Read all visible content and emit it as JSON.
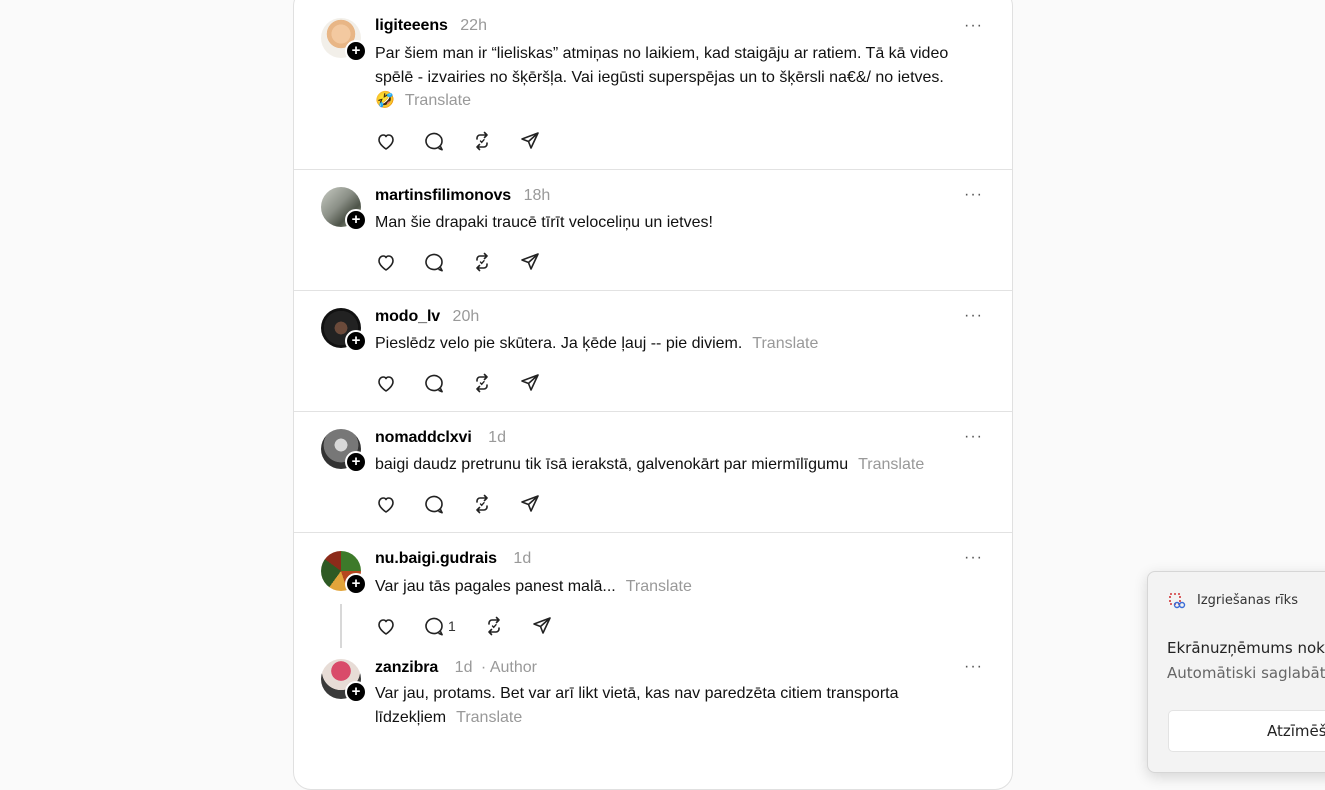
{
  "posts": [
    {
      "username": "ligiteeens",
      "time": "22h",
      "text_lines": [
        "Par šiem man ir “lieliskas” atmiņas no laikiem, kad staigāju ar ratiem. Tā kā video",
        "spēlē - izvairies no šķēršļa. Vai iegūsti superspējas un to šķērsli na€&/ no ietves."
      ],
      "emoji": "🤣",
      "translate": "Translate",
      "reply_count": ""
    },
    {
      "username": "martinsfilimonovs",
      "time": "18h",
      "text_lines": [
        "Man šie drapaki traucē tīrīt veloceliņu un ietves!"
      ],
      "translate": "",
      "reply_count": ""
    },
    {
      "username": "modo_lv",
      "time": "20h",
      "text_lines": [
        "Pieslēdz velo pie skūtera. Ja ķēde ļauj -- pie diviem."
      ],
      "translate": "Translate",
      "reply_count": ""
    },
    {
      "username": "nomaddclxvi",
      "time": "1d",
      "text_lines": [
        "baigi daudz pretrunu tik īsā ierakstā, galvenokārt par miermīlīgumu"
      ],
      "translate": "Translate",
      "reply_count": ""
    },
    {
      "username": "nu.baigi.gudrais",
      "time": "1d",
      "text_lines": [
        "Var jau tās pagales panest malā..."
      ],
      "translate": "Translate",
      "reply_count": "1"
    },
    {
      "username": "zanzibra",
      "time": "1d",
      "author_label": "· Author",
      "text_lines": [
        "Var jau, protams. Bet var arī likt vietā, kas nav paredzēta citiem transporta",
        "līdzekļiem"
      ],
      "translate": "Translate"
    }
  ],
  "more_label": "···",
  "snipping_toast": {
    "title": "Izgriešanas rīks",
    "line1": "Ekrānuzņēmums nok",
    "line2": "Automātiski saglabāt",
    "button": "Atzīmēš"
  },
  "colors": {
    "background": "#fafafa",
    "card": "#ffffff",
    "muted_text": "#999999",
    "divider": "#e2e2e2"
  },
  "icons": [
    "heart-icon",
    "comment-icon",
    "repost-icon",
    "share-icon",
    "more-icon",
    "follow-plus-icon",
    "snipping-tool-icon"
  ]
}
